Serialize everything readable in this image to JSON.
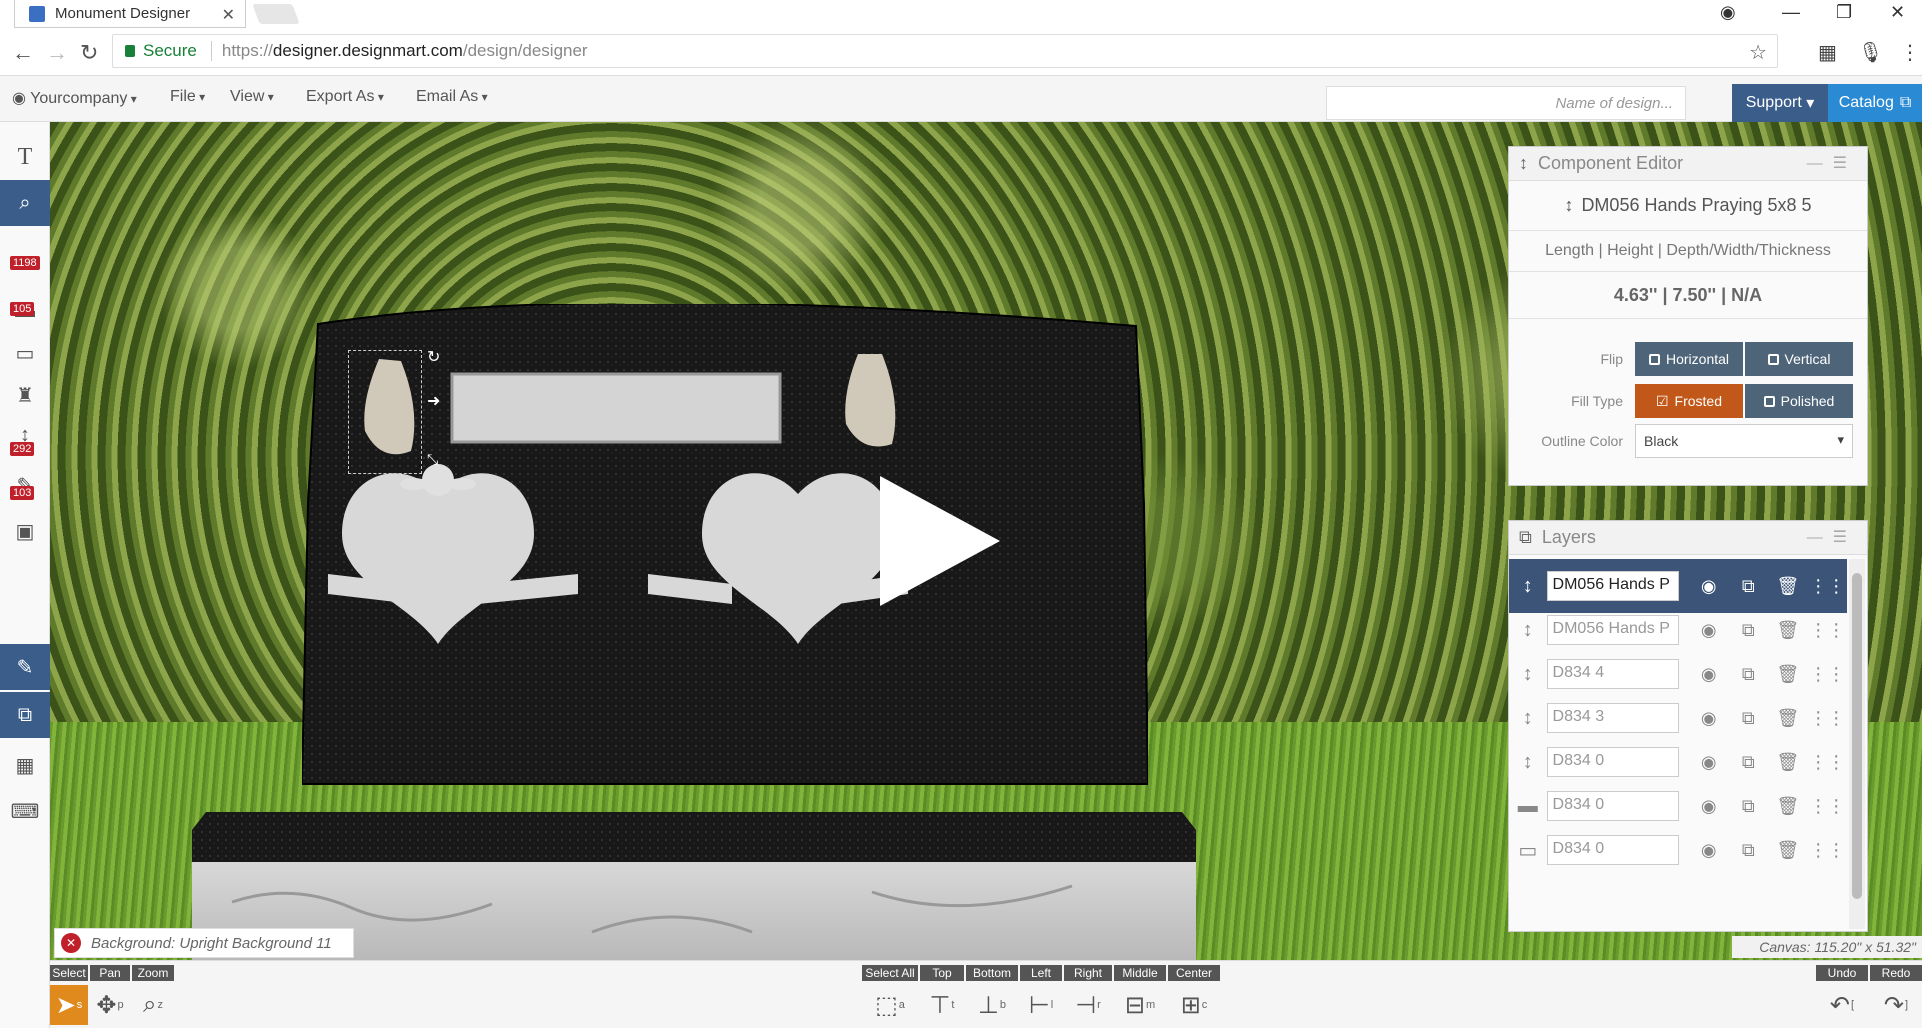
{
  "browser": {
    "tab_title": "Monument Designer",
    "tab_close": "✕",
    "secure_label": "Secure",
    "url_scheme": "https://",
    "url_host": "designer.designmart.com",
    "url_path": "/design/designer"
  },
  "menubar": {
    "company": "Yourcompany",
    "file": "File",
    "view": "View",
    "export": "Export As",
    "email": "Email As",
    "design_name_placeholder": "Name of design...",
    "support": "Support",
    "catalog": "Catalog"
  },
  "left_toolbar": {
    "badges": [
      "1198",
      "105",
      "292",
      "103"
    ]
  },
  "component_editor": {
    "title": "Component Editor",
    "component_name": "DM056 Hands Praying 5x8 5",
    "dims_label": "Length | Height | Depth/Width/Thickness",
    "dims_value": "4.63'' | 7.50'' | N/A",
    "flip_label": "Flip",
    "flip_horizontal": "Horizontal",
    "flip_vertical": "Vertical",
    "fill_type_label": "Fill Type",
    "fill_frosted": "Frosted",
    "fill_polished": "Polished",
    "outline_label": "Outline Color",
    "outline_value": "Black"
  },
  "layers": {
    "title": "Layers",
    "items": [
      {
        "name": "DM056 Hands P",
        "type_icon": "text-size-icon",
        "active": true
      },
      {
        "name": "DM056 Hands P",
        "type_icon": "text-size-icon",
        "active": false
      },
      {
        "name": "D834 4",
        "type_icon": "text-size-icon",
        "active": false
      },
      {
        "name": "D834 3",
        "type_icon": "text-size-icon",
        "active": false
      },
      {
        "name": "D834 0",
        "type_icon": "text-size-icon",
        "active": false
      },
      {
        "name": "D834 0",
        "type_icon": "tablet-icon",
        "active": false
      },
      {
        "name": "D834 0",
        "type_icon": "base-icon",
        "active": false
      }
    ]
  },
  "status": {
    "background": "Background: Upright Background 11",
    "canvas_size": "Canvas: 115.20\" x 51.32\""
  },
  "bottom_toolbar": {
    "select": "Select",
    "pan": "Pan",
    "zoom": "Zoom",
    "select_all": "Select All",
    "top": "Top",
    "bottom": "Bottom",
    "left": "Left",
    "right": "Right",
    "middle": "Middle",
    "center": "Center",
    "undo": "Undo",
    "redo": "Redo",
    "shortcuts": {
      "select": "s",
      "pan": "p",
      "zoom": "z",
      "select_all": "a",
      "top": "t",
      "bottom": "b",
      "left": "l",
      "right": "r",
      "middle": "m",
      "center": "c",
      "undo": "[",
      "redo": "]"
    }
  },
  "colors": {
    "accent_blue": "#3a5d8a",
    "catalog_blue": "#2a8ad4",
    "active_orange": "#c1581a",
    "tool_orange": "#e08a1e",
    "badge_red": "#c0202a",
    "layer_active": "#3b5478"
  }
}
